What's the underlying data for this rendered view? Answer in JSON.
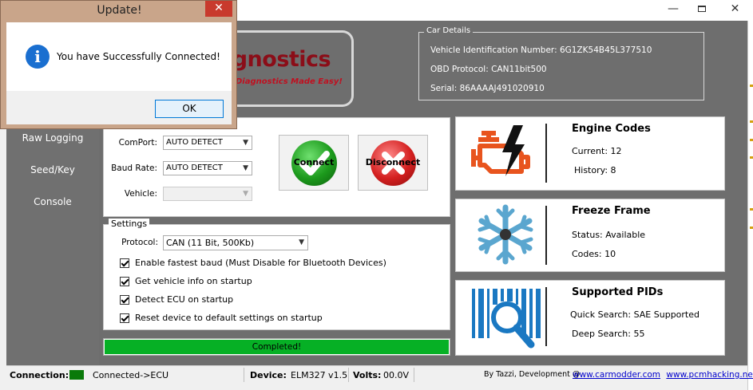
{
  "window": {
    "minimize_glyph": "—",
    "close_glyph": "✕"
  },
  "sidebar": {
    "items": [
      {
        "label": "Raw Logging"
      },
      {
        "label": "Seed/Key"
      },
      {
        "label": "Console"
      }
    ]
  },
  "header": {
    "logo_text": "agnostics",
    "logo_tagline": "Diagnostics Made Easy!"
  },
  "car_details": {
    "legend": "Car Details",
    "vin": "Vehicle Identification Number: 6G1ZK54B45L377510",
    "obd_protocol": "OBD Protocol: CAN11bit500",
    "serial": "Serial: 86AAAAJ491020910"
  },
  "connection": {
    "comport_label": "ComPort:",
    "comport_value": "AUTO DETECT",
    "baud_label": "Baud Rate:",
    "baud_value": "AUTO DETECT",
    "vehicle_label": "Vehicle:",
    "vehicle_value": "",
    "connect_label": "Connect",
    "disconnect_label": "Disconnect"
  },
  "settings": {
    "legend": "Settings",
    "protocol_label": "Protocol:",
    "protocol_value": "CAN (11 Bit, 500Kb)",
    "options": [
      {
        "label": "Enable fastest baud (Must Disable for Bluetooth Devices)",
        "checked": true
      },
      {
        "label": "Get vehicle info on startup",
        "checked": true
      },
      {
        "label": "Detect ECU on startup",
        "checked": true
      },
      {
        "label": "Reset device to default settings on startup",
        "checked": true
      }
    ]
  },
  "progress": {
    "label": "Completed!",
    "value": 1.0,
    "color": "#06b025"
  },
  "cards": {
    "engine_codes": {
      "title": "Engine Codes",
      "line1": "Current: 12",
      "line2": "History: 8",
      "icon": "engine-warning-icon",
      "icon_color": "#e8541e"
    },
    "freeze_frame": {
      "title": "Freeze Frame",
      "line1": "Status: Available",
      "line2": "Codes: 10",
      "icon": "snowflake-icon",
      "icon_color": "#5aa6cf"
    },
    "supported_pids": {
      "title": "Supported PIDs",
      "line1": "Quick Search: SAE Supported",
      "line2": "Deep Search: 55",
      "icon": "barcode-search-icon",
      "icon_color": "#1a78c2"
    }
  },
  "statusbar": {
    "connection_label": "Connection:",
    "connection_value": "Connected->ECU",
    "connection_color": "#0a7a0a",
    "device_label": "Device:",
    "device_value": "ELM327 v1.5",
    "volts_label": "Volts:",
    "volts_value": "00.0V",
    "credit": "By Tazzi, Development @",
    "link1": "www.carmodder.com",
    "link2": "www.pcmhacking.net"
  },
  "dialog": {
    "title": "Update!",
    "close_glyph": "✕",
    "message": "You have Successfully Connected!",
    "ok_label": "OK",
    "icon": "info-icon",
    "info_glyph": "i"
  }
}
